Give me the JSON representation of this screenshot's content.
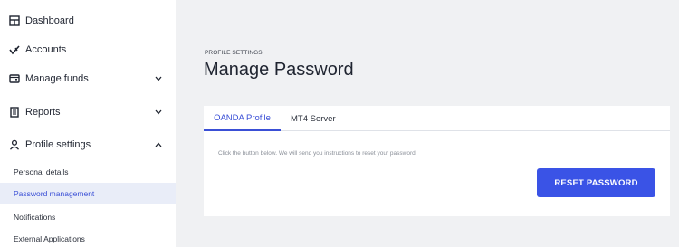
{
  "sidebar": {
    "items": [
      {
        "label": "Dashboard",
        "icon": "dashboard-icon"
      },
      {
        "label": "Accounts",
        "icon": "accounts-icon"
      },
      {
        "label": "Manage funds",
        "icon": "wallet-icon",
        "chevron": "down"
      },
      {
        "label": "Reports",
        "icon": "reports-icon",
        "chevron": "down"
      },
      {
        "label": "Profile settings",
        "icon": "user-icon",
        "chevron": "up"
      }
    ],
    "sub_items": [
      {
        "label": "Personal details"
      },
      {
        "label": "Password management",
        "active": true
      },
      {
        "label": "Notifications"
      },
      {
        "label": "External Applications"
      }
    ]
  },
  "main": {
    "kicker": "PROFILE SETTINGS",
    "title": "Manage Password",
    "tabs": [
      {
        "label": "OANDA Profile",
        "active": true
      },
      {
        "label": "MT4 Server"
      }
    ],
    "help_text": "Click the button below. We will send you instructions to reset your password.",
    "button_label": "RESET PASSWORD"
  },
  "colors": {
    "accent": "#3a53e6",
    "active_bg": "#e9edf8",
    "page_bg": "#f0f1f3"
  }
}
